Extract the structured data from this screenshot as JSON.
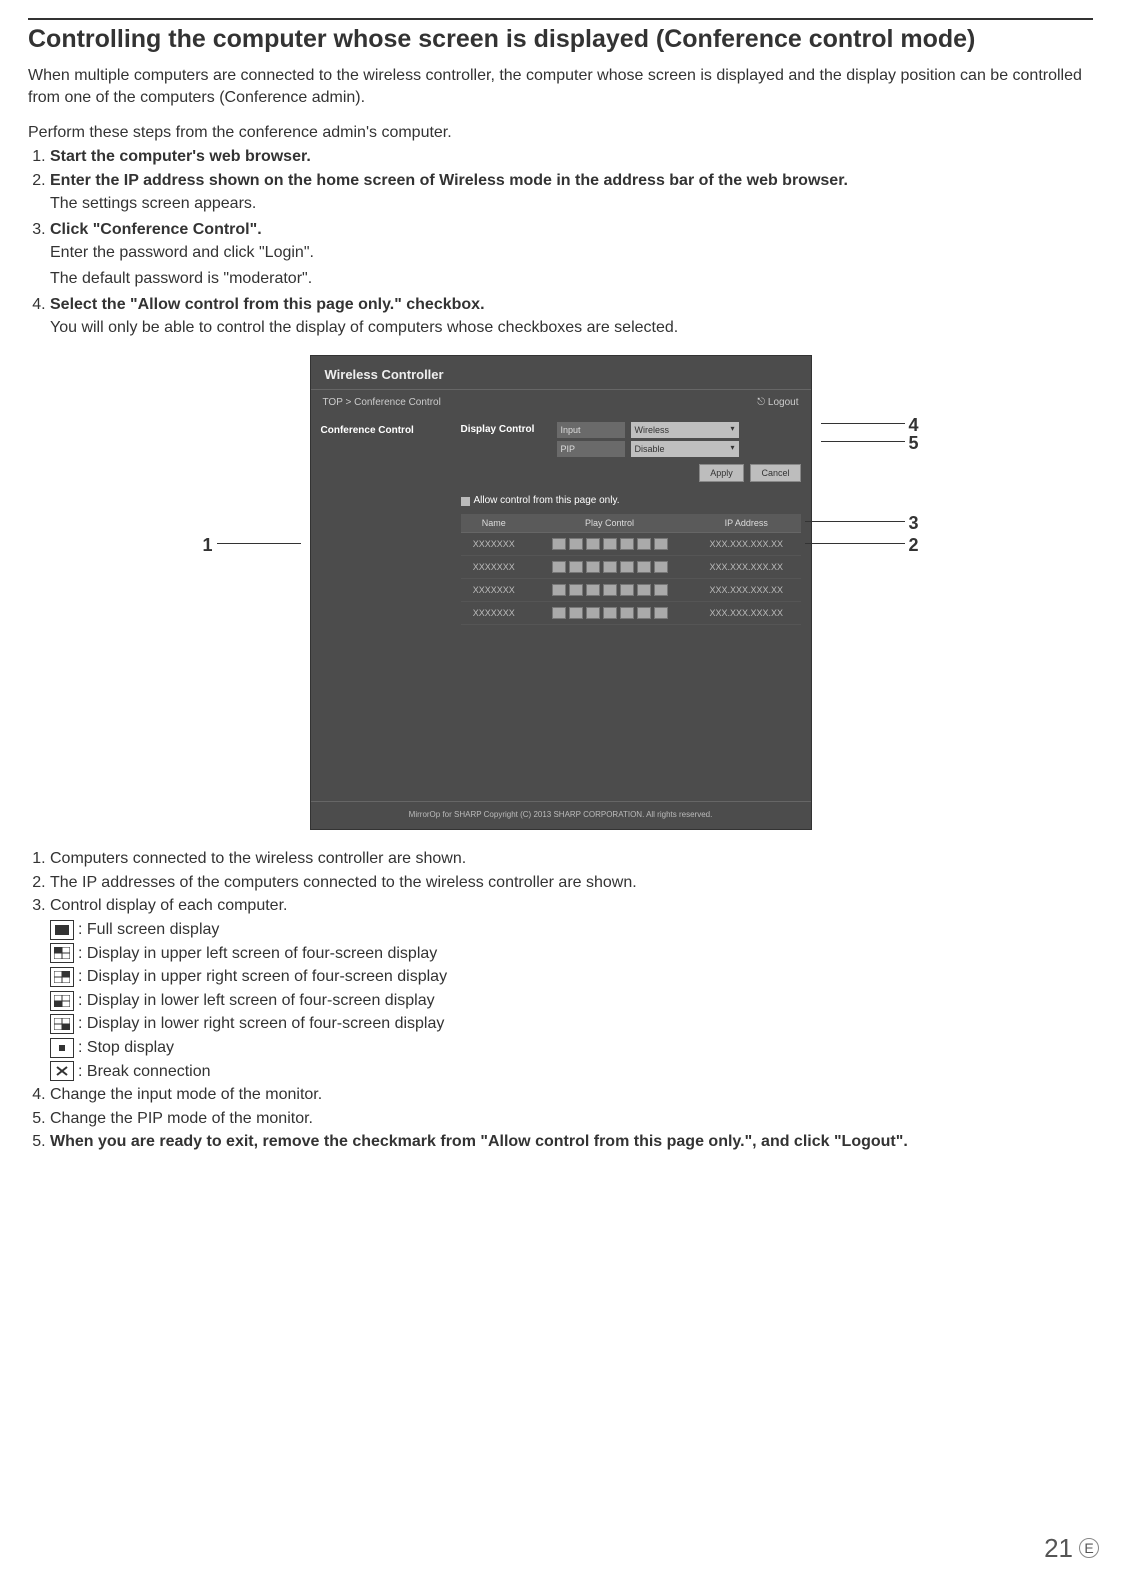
{
  "title": "Controlling the computer whose screen is displayed (Conference control mode)",
  "intro": "When multiple computers are connected to the wireless controller, the computer whose screen is displayed and the display position can be controlled from one of the computers (Conference admin).",
  "lead": "Perform these steps from the conference admin's computer.",
  "steps": [
    {
      "head": "Start the computer's web browser.",
      "body": []
    },
    {
      "head": "Enter the IP address shown on the home screen of Wireless mode in the address bar of the web browser.",
      "body": [
        "The settings screen appears."
      ]
    },
    {
      "head": "Click \"Conference Control\".",
      "body": [
        "Enter the password and click \"Login\".",
        "The default password is \"moderator\"."
      ]
    },
    {
      "head": "Select the \"Allow control from this page only.\" checkbox.",
      "body": [
        "You will only be able to control the display of computers whose checkboxes are selected."
      ]
    }
  ],
  "panel": {
    "title": "Wireless Controller",
    "breadcrumb": "TOP > Conference Control",
    "logout": "⎋ Logout",
    "side_item": "Conference Control",
    "display_control": "Display Control",
    "input_label": "Input",
    "input_value": "Wireless",
    "pip_label": "PIP",
    "pip_value": "Disable",
    "apply": "Apply",
    "cancel": "Cancel",
    "allow_label": "Allow control from this page only.",
    "th_name": "Name",
    "th_play": "Play Control",
    "th_ip": "IP Address",
    "rows": [
      {
        "name": "XXXXXXX",
        "ip": "XXX.XXX.XXX.XX"
      },
      {
        "name": "XXXXXXX",
        "ip": "XXX.XXX.XXX.XX"
      },
      {
        "name": "XXXXXXX",
        "ip": "XXX.XXX.XXX.XX"
      },
      {
        "name": "XXXXXXX",
        "ip": "XXX.XXX.XXX.XX"
      }
    ],
    "copyright": "MirrorOp for SHARP Copyright (C) 2013 SHARP CORPORATION. All rights reserved."
  },
  "callouts": {
    "c1": "1",
    "c2": "2",
    "c3": "3",
    "c4": "4",
    "c5": "5"
  },
  "notes": [
    "Computers connected to the wireless controller are shown.",
    "The IP addresses of the computers connected to the wireless controller are shown.",
    "Control display of each computer."
  ],
  "icon_legend": [
    {
      "name": "full-screen-icon",
      "text": ": Full screen display"
    },
    {
      "name": "upper-left-icon",
      "text": ": Display in upper left screen of four-screen display"
    },
    {
      "name": "upper-right-icon",
      "text": ": Display in upper right screen of four-screen display"
    },
    {
      "name": "lower-left-icon",
      "text": ": Display in lower left screen of four-screen display"
    },
    {
      "name": "lower-right-icon",
      "text": ": Display in lower right screen of four-screen display"
    },
    {
      "name": "stop-icon",
      "text": ": Stop display"
    },
    {
      "name": "break-icon",
      "text": ": Break connection"
    }
  ],
  "notes_tail": [
    "Change the input mode of the monitor.",
    "Change the PIP mode of the monitor."
  ],
  "final_step": "When you are ready to exit, remove the checkmark from \"Allow control from this page only.\", and click \"Logout\".",
  "page_number": "21",
  "page_region": "E"
}
